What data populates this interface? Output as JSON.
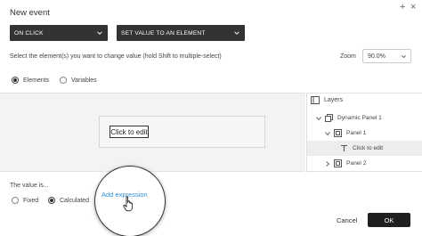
{
  "dialog": {
    "title": "New event",
    "add_symbol": "+",
    "close_symbol": "×"
  },
  "event_dropdown": {
    "value": "ON CLICK"
  },
  "action_dropdown": {
    "value": "SET VALUE TO AN ELEMENT"
  },
  "instruction": "Select the element(s) you want to change value (hold Shift to multiple-select)",
  "zoom": {
    "label": "Zoom",
    "value": "90.0%"
  },
  "target_type": {
    "options": [
      {
        "label": "Elements",
        "selected": true
      },
      {
        "label": "Variables",
        "selected": false
      }
    ]
  },
  "canvas": {
    "element_text": "Click to edit"
  },
  "layers": {
    "title": "Layers",
    "items": [
      {
        "label": "Dynamic Panel 1",
        "icon": "dynamic-panel-icon",
        "expander": "caret-down",
        "selected": false
      },
      {
        "label": "Panel 1",
        "icon": "panel-icon",
        "expander": "caret-down",
        "selected": false
      },
      {
        "label": "Click to edit",
        "icon": "text-icon",
        "expander": "",
        "selected": true
      },
      {
        "label": "Panel 2",
        "icon": "panel-icon",
        "expander": "caret-right",
        "selected": false
      }
    ]
  },
  "value_section": {
    "label": "The value is...",
    "options": [
      {
        "label": "Fixed",
        "selected": false
      },
      {
        "label": "Calculated",
        "selected": true
      }
    ],
    "add_expression": "Add expression"
  },
  "footer": {
    "cancel_label": "Cancel",
    "ok_label": "OK"
  },
  "colors": {
    "accent": "#2f8fd9",
    "dark": "#333333",
    "ok_button": "#1f1f1f"
  }
}
